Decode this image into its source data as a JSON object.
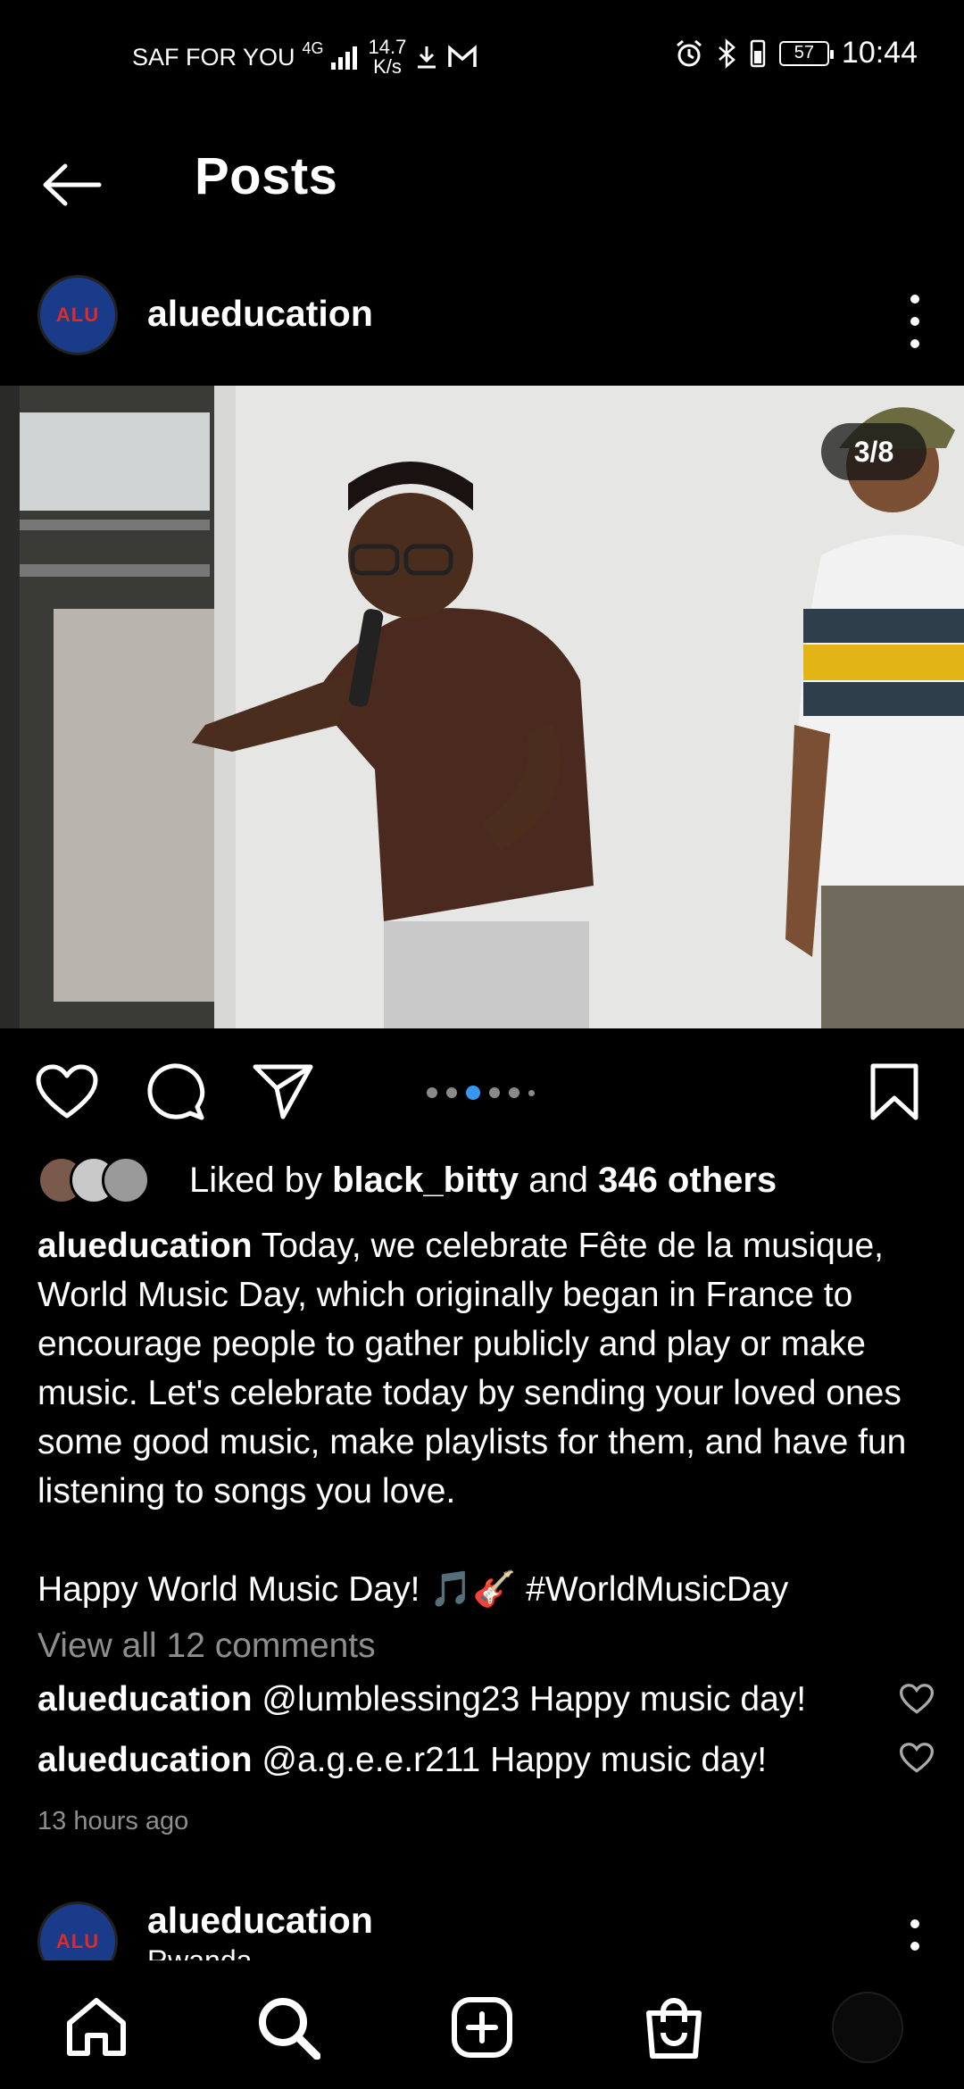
{
  "status_bar": {
    "carrier": "SAF FOR YOU",
    "network": "4G",
    "speed_value": "14.7",
    "speed_unit": "K/s",
    "battery": "57",
    "time": "10:44"
  },
  "header": {
    "title": "Posts"
  },
  "post": {
    "username": "alueducation",
    "avatar_text": "ALU",
    "image_counter": "3/8",
    "carousel": {
      "total_dots": 6,
      "active_index": 2
    },
    "likes": {
      "prefix": "Liked by",
      "user": "black_bitty",
      "middle": "and",
      "others": "346 others"
    },
    "caption": {
      "username": "alueducation",
      "text": "Today, we celebrate Fête de la musique, World Music Day, which originally began in France to encourage people to gather publicly and play or make music. Let's celebrate today by sending your loved ones some good music, make playlists for them, and have fun listening to songs you love.",
      "line2": "Happy World Music Day! 🎵🎸",
      "hashtag": "#WorldMusicDay"
    },
    "view_all_comments": "View all 12 comments",
    "comments": [
      {
        "user": "alueducation",
        "text": "@lumblessing23 Happy music day!"
      },
      {
        "user": "alueducation",
        "text": "@a.g.e.e.r211 Happy music day!"
      }
    ],
    "time_ago": "13 hours ago"
  },
  "next_post": {
    "username": "alueducation",
    "location": "Rwanda",
    "avatar_text": "ALU"
  },
  "icons": {
    "back": "arrow-left-icon",
    "more": "more-vertical-icon",
    "like": "heart-icon",
    "comment": "comment-icon",
    "share": "send-icon",
    "save": "bookmark-icon",
    "nav": [
      "home-icon",
      "search-icon",
      "add-post-icon",
      "shop-icon",
      "profile-avatar"
    ]
  }
}
